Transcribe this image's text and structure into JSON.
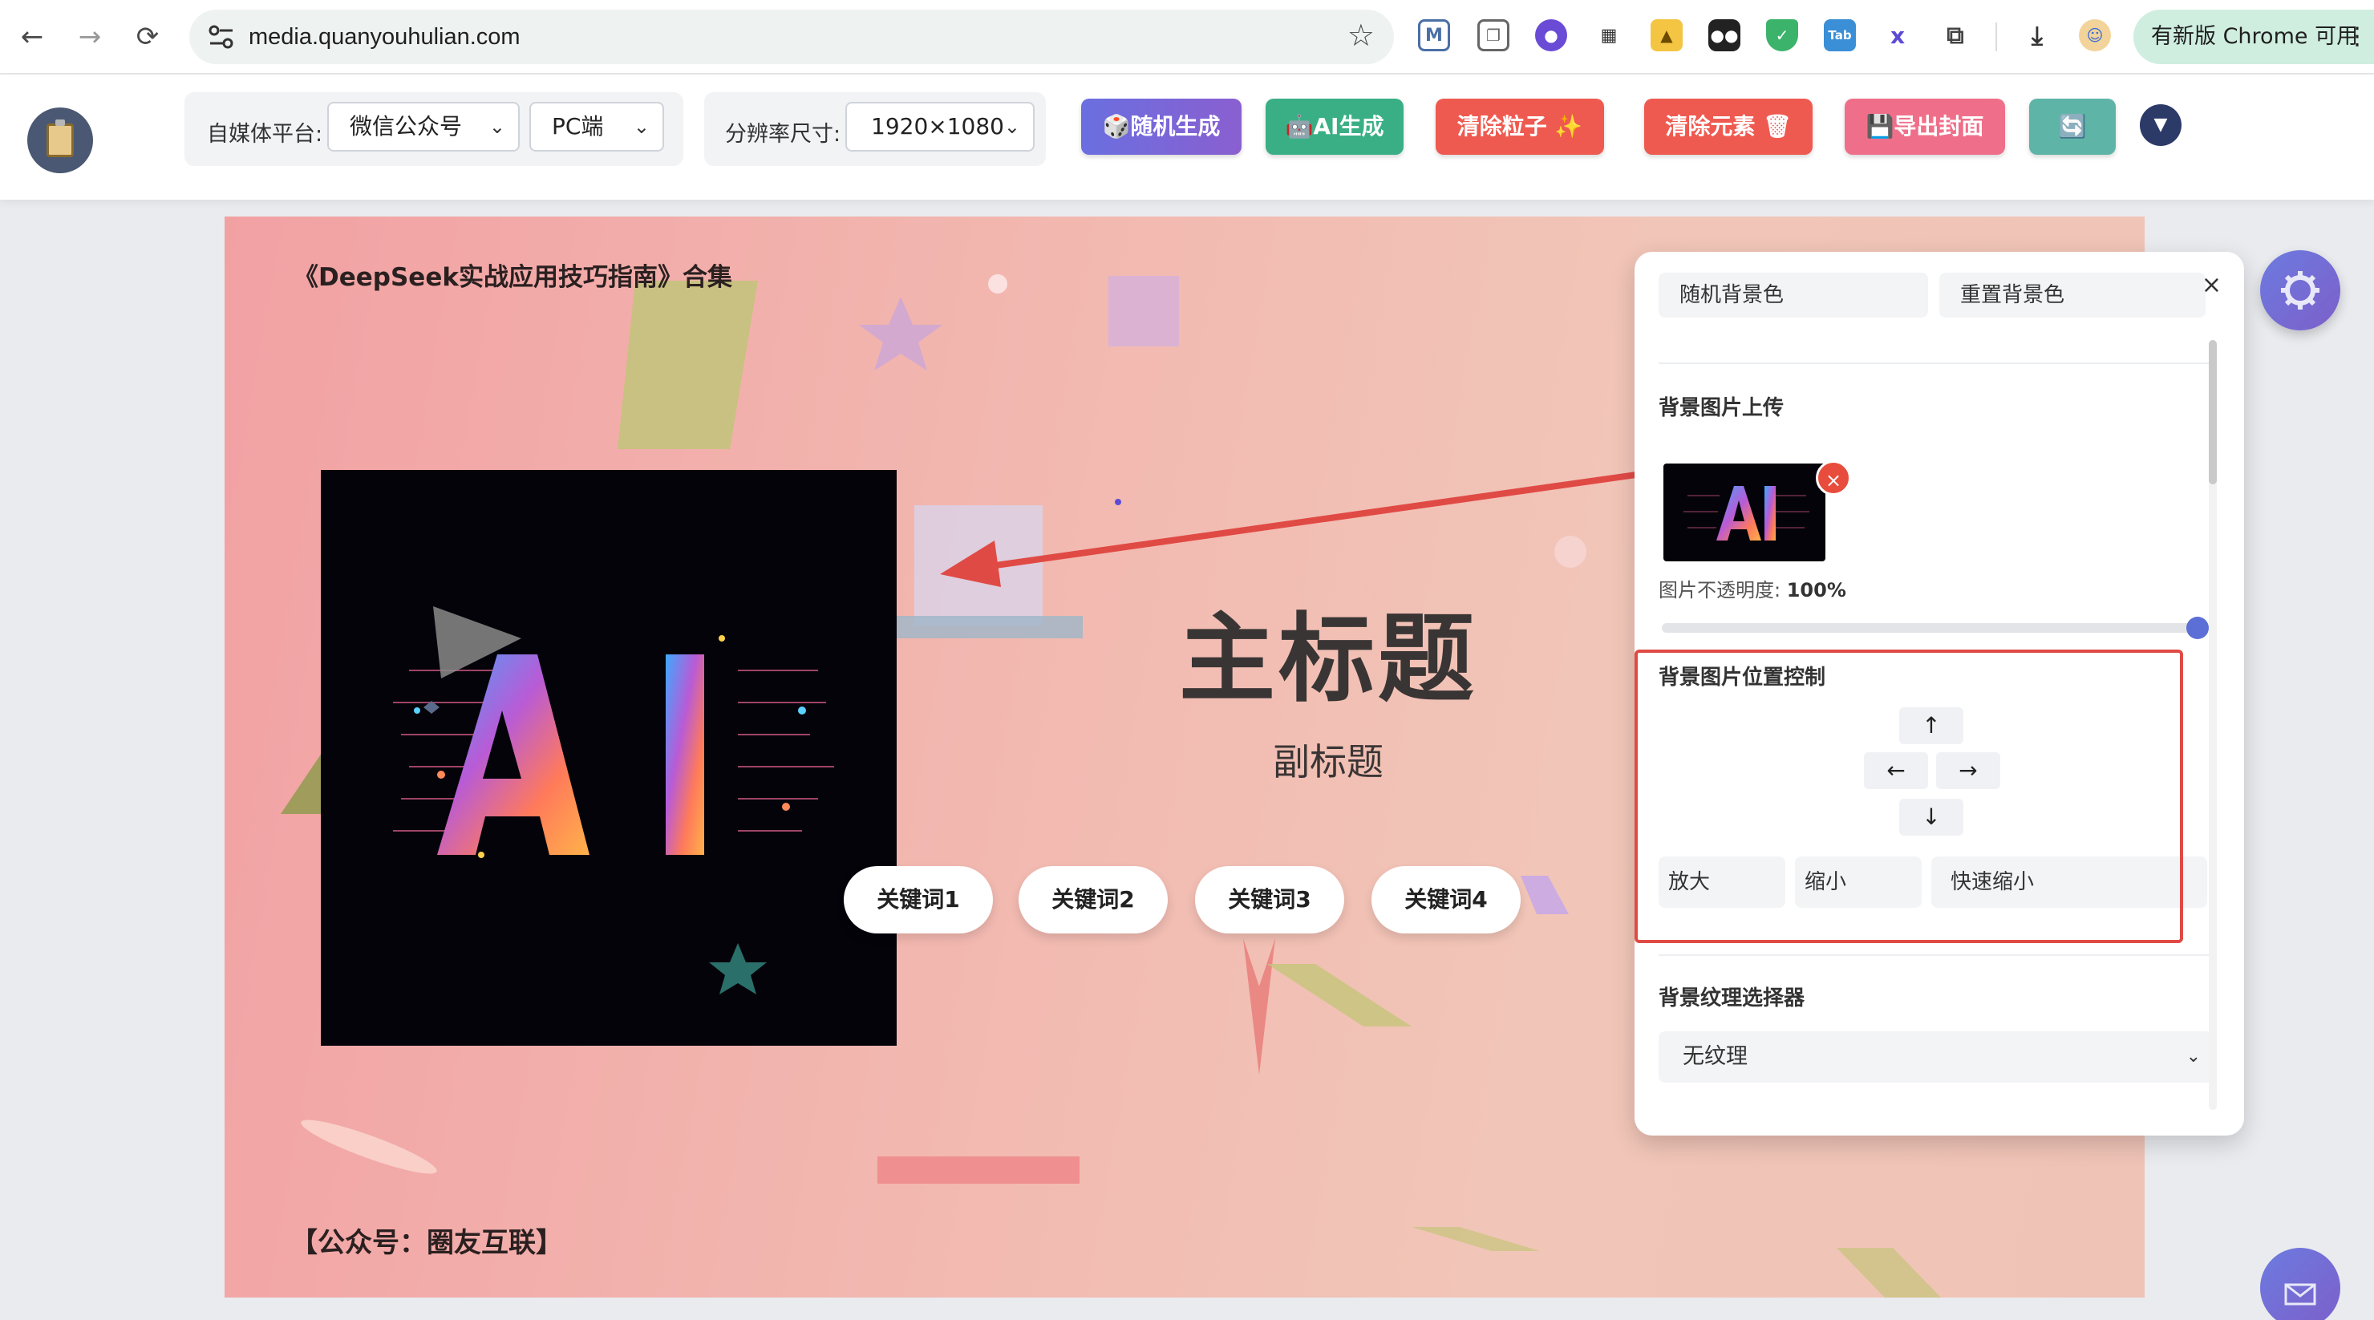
{
  "browser": {
    "url": "media.quanyouhulian.com",
    "update_label": "有新版 Chrome 可用",
    "ext_tab_label": "Tab"
  },
  "toolbar": {
    "platform_label": "自媒体平台:",
    "platform_value": "微信公众号",
    "device_value": "PC端",
    "resolution_label": "分辨率尺寸:",
    "resolution_value": "1920×1080",
    "random_generate": "🎲随机生成",
    "ai_generate": "🤖AI生成",
    "clear_particles": "清除粒子 ✨",
    "clear_elements": "清除元素 🗑",
    "export_cover": "💾导出封面",
    "refresh": "🔄",
    "more": "▼"
  },
  "canvas": {
    "collection_title": "《DeepSeek实战应用技巧指南》合集",
    "image_text": "AI",
    "main_title": "主标题",
    "sub_title": "副标题",
    "keywords": [
      "关键词1",
      "关键词2",
      "关键词3",
      "关键词4"
    ],
    "footer": "【公众号：圈友互联】"
  },
  "panel": {
    "random_bg": "随机背景色",
    "reset_bg": "重置背景色",
    "close": "×",
    "upload_title": "背景图片上传",
    "thumb_remove": "×",
    "opacity_label": "图片不透明度:",
    "opacity_value": "100%",
    "position_title": "背景图片位置控制",
    "up": "↑",
    "left": "←",
    "right": "→",
    "down": "↓",
    "zoom_in": "放大",
    "zoom_out": "缩小",
    "quick_zoom_out": "快速缩小",
    "texture_title": "背景纹理选择器",
    "texture_value": "无纹理"
  },
  "colors": {
    "accent_red": "#e04a45",
    "btn_random": "#6a6fe0",
    "btn_ai": "#3aaf86",
    "btn_clear": "#ef5a50",
    "btn_export": "#ef6f8a",
    "btn_refresh": "#5fb4a8"
  }
}
